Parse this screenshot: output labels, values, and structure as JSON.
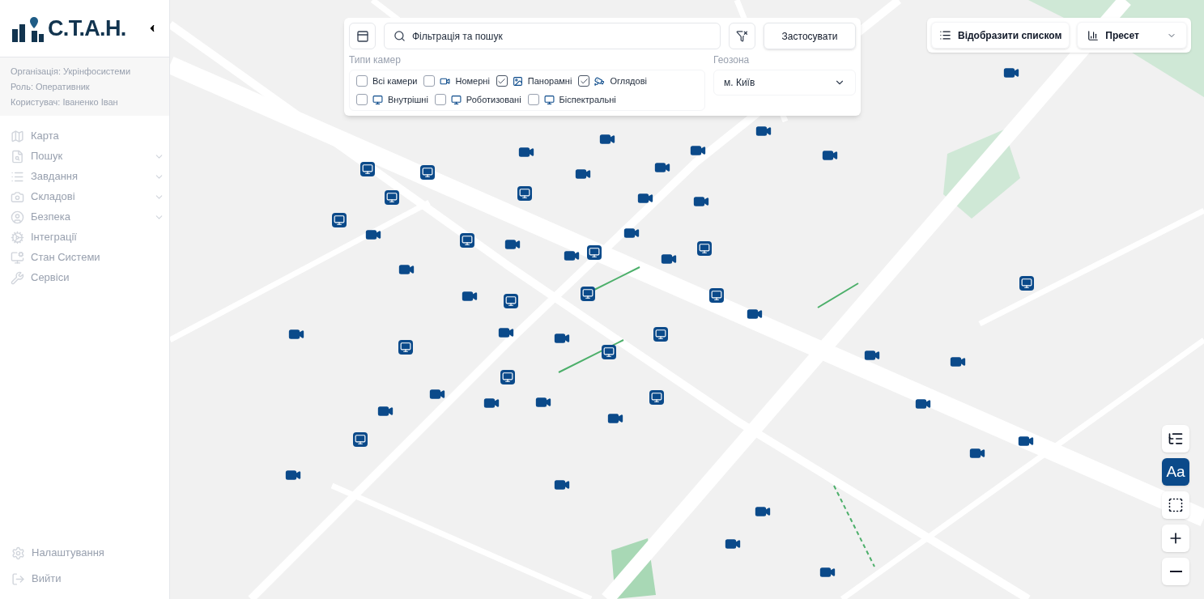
{
  "logo": {
    "text": "С.Т.А.Н."
  },
  "sidebar": {
    "user_info": [
      "Організація: Укрінфосистеми",
      "Роль: Оперативник",
      "Користувач: Іваненко Іван"
    ],
    "items": [
      {
        "label": "Карта",
        "kind": "map",
        "expandable": false
      },
      {
        "label": "Пошук",
        "kind": "search",
        "expandable": true
      },
      {
        "label": "Завдання",
        "kind": "tasks",
        "expandable": true
      },
      {
        "label": "Складові",
        "kind": "camera",
        "expandable": true
      },
      {
        "label": "Безпека",
        "kind": "user",
        "expandable": true
      },
      {
        "label": "Інтеграції",
        "kind": "integration",
        "expandable": false
      },
      {
        "label": "Стан Системи",
        "kind": "status",
        "expandable": false
      },
      {
        "label": "Сервіси",
        "kind": "services",
        "expandable": false
      }
    ],
    "bottom_items": [
      {
        "label": "Налаштування",
        "kind": "settings"
      },
      {
        "label": "Вийти",
        "kind": "logout"
      }
    ]
  },
  "filter": {
    "search": {
      "placeholder": "Фільтрація та пошук"
    },
    "apply_button": "Застосувати",
    "camera_types_label": "Типи камер",
    "camera_types": [
      {
        "label": "Всі камери",
        "kind": "all",
        "checked": false
      },
      {
        "label": "Номерні",
        "kind": "plate",
        "checked": false
      },
      {
        "label": "Панорамні",
        "kind": "panorama",
        "checked": true
      },
      {
        "label": "Оглядові",
        "kind": "overview",
        "checked": true
      },
      {
        "label": "Внутрішні",
        "kind": "indoor",
        "checked": false
      },
      {
        "label": "Роботизовані",
        "kind": "indoor",
        "checked": false
      },
      {
        "label": "Біспектральні",
        "kind": "indoor",
        "checked": false
      }
    ],
    "geozone_label": "Геозона",
    "geozone": "м. Київ"
  },
  "top_right": {
    "list_button": "Відобразити списком",
    "preset": "Пресет"
  },
  "map_controls": [
    {
      "kind": "legend",
      "selected": false
    },
    {
      "kind": "labels",
      "text": "Aa",
      "selected": true
    },
    {
      "kind": "area",
      "selected": false
    },
    {
      "kind": "zoom_in",
      "selected": false
    },
    {
      "kind": "zoom_out",
      "selected": false
    }
  ]
}
